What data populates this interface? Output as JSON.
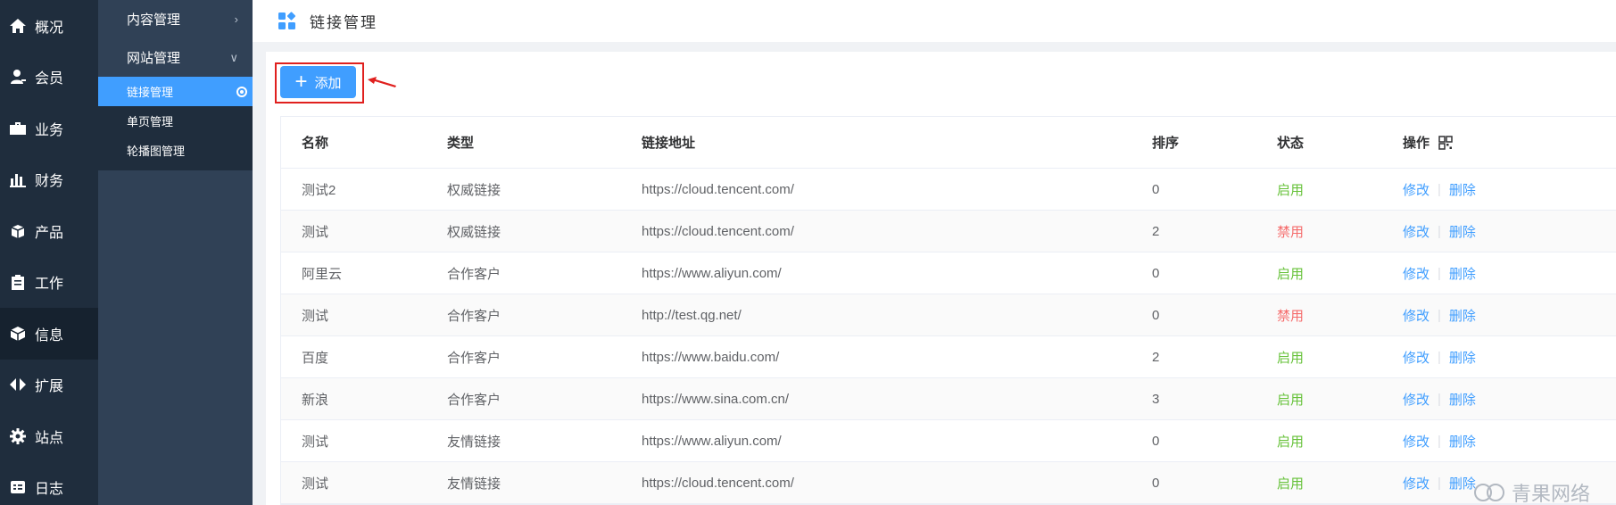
{
  "nav": [
    {
      "label": "概况",
      "icon": "home-icon"
    },
    {
      "label": "会员",
      "icon": "user-icon"
    },
    {
      "label": "业务",
      "icon": "briefcase-icon"
    },
    {
      "label": "财务",
      "icon": "bar-chart-icon"
    },
    {
      "label": "产品",
      "icon": "package-icon"
    },
    {
      "label": "工作",
      "icon": "clipboard-icon"
    },
    {
      "label": "信息",
      "icon": "cube-icon",
      "active": true
    },
    {
      "label": "扩展",
      "icon": "expand-arrows-icon"
    },
    {
      "label": "站点",
      "icon": "gear-icon"
    },
    {
      "label": "日志",
      "icon": "log-icon"
    }
  ],
  "submenu": {
    "content_mgmt": "内容管理",
    "site_mgmt": "网站管理",
    "items": [
      "链接管理",
      "单页管理",
      "轮播图管理"
    ]
  },
  "header": {
    "title": "链接管理",
    "icon": "dashboard-grid-icon"
  },
  "toolbar": {
    "add_label": "添加"
  },
  "table": {
    "headers": [
      "名称",
      "类型",
      "链接地址",
      "排序",
      "状态",
      "操作"
    ],
    "rows": [
      {
        "name": "测试2",
        "type": "权威链接",
        "url": "https://cloud.tencent.com/",
        "order": "0",
        "status": "启用"
      },
      {
        "name": "测试",
        "type": "权威链接",
        "url": "https://cloud.tencent.com/",
        "order": "2",
        "status": "禁用"
      },
      {
        "name": "阿里云",
        "type": "合作客户",
        "url": "https://www.aliyun.com/",
        "order": "0",
        "status": "启用"
      },
      {
        "name": "测试",
        "type": "合作客户",
        "url": "http://test.qg.net/",
        "order": "0",
        "status": "禁用"
      },
      {
        "name": "百度",
        "type": "合作客户",
        "url": "https://www.baidu.com/",
        "order": "2",
        "status": "启用"
      },
      {
        "name": "新浪",
        "type": "合作客户",
        "url": "https://www.sina.com.cn/",
        "order": "3",
        "status": "启用"
      },
      {
        "name": "测试",
        "type": "友情链接",
        "url": "https://www.aliyun.com/",
        "order": "0",
        "status": "启用"
      },
      {
        "name": "测试",
        "type": "友情链接",
        "url": "https://cloud.tencent.com/",
        "order": "0",
        "status": "启用"
      }
    ],
    "edit_label": "修改",
    "delete_label": "删除",
    "sep": "|"
  },
  "colors": {
    "accent": "#409eff",
    "enabled": "#67c23a",
    "disabled": "#f56c6c",
    "highlight": "#e0201e"
  },
  "watermark": "青果网络"
}
